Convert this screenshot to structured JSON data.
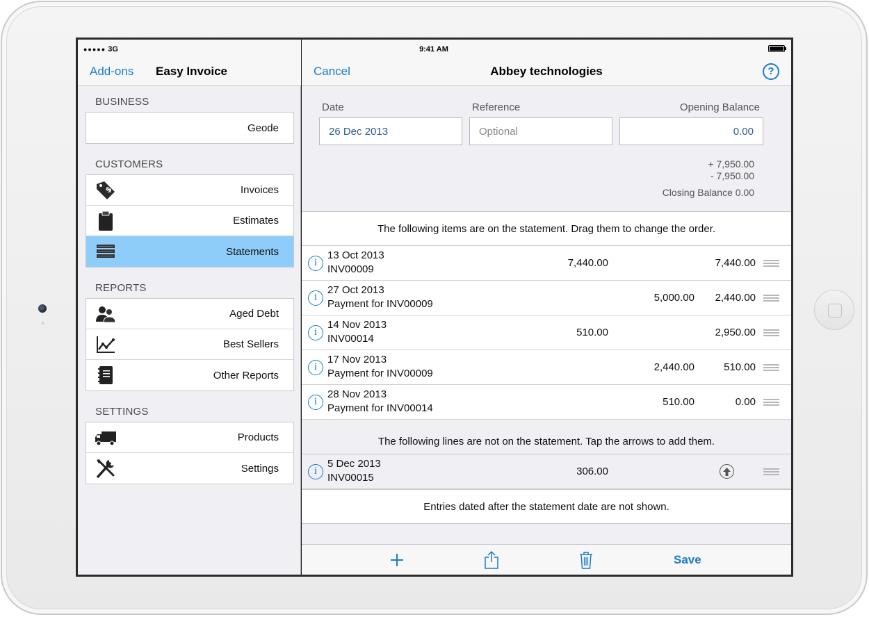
{
  "status": {
    "carrier": "3G",
    "time": "9:41 AM"
  },
  "master": {
    "addons_label": "Add-ons",
    "title": "Easy Invoice",
    "sections": {
      "business": "BUSINESS",
      "customers": "CUSTOMERS",
      "reports": "REPORTS",
      "settings": "SETTINGS"
    },
    "business_item": "Geode",
    "customers_items": [
      {
        "label": "Invoices",
        "icon": "price-tag-icon"
      },
      {
        "label": "Estimates",
        "icon": "clipboard-icon"
      },
      {
        "label": "Statements",
        "icon": "document-stack-icon",
        "selected": true
      }
    ],
    "reports_items": [
      {
        "label": "Aged Debt",
        "icon": "people-icon"
      },
      {
        "label": "Best Sellers",
        "icon": "line-chart-icon"
      },
      {
        "label": "Other Reports",
        "icon": "notebook-icon"
      }
    ],
    "settings_items": [
      {
        "label": "Products",
        "icon": "truck-icon"
      },
      {
        "label": "Settings",
        "icon": "tools-icon"
      }
    ]
  },
  "detail": {
    "cancel_label": "Cancel",
    "title": "Abbey technologies",
    "help_label": "?",
    "form": {
      "date_label": "Date",
      "date_value": "26 Dec 2013",
      "reference_label": "Reference",
      "reference_placeholder": "Optional",
      "opening_label": "Opening Balance",
      "opening_value": "0.00"
    },
    "summary": {
      "plus": "+ 7,950.00",
      "minus": "- 7,950.00",
      "closing": "Closing Balance 0.00"
    },
    "on_statement_notice": "The following items are on the statement. Drag them to change the order.",
    "entries": [
      {
        "date": "13 Oct 2013",
        "desc": "INV00009",
        "debit": "7,440.00",
        "credit": "",
        "balance": "7,440.00"
      },
      {
        "date": "27 Oct 2013",
        "desc": "Payment for INV00009",
        "debit": "",
        "credit": "5,000.00",
        "balance": "2,440.00"
      },
      {
        "date": "14 Nov 2013",
        "desc": "INV00014",
        "debit": "510.00",
        "credit": "",
        "balance": "2,950.00"
      },
      {
        "date": "17 Nov 2013",
        "desc": "Payment for INV00009",
        "debit": "",
        "credit": "2,440.00",
        "balance": "510.00"
      },
      {
        "date": "28 Nov 2013",
        "desc": "Payment for INV00014",
        "debit": "",
        "credit": "510.00",
        "balance": "0.00"
      }
    ],
    "off_statement_notice": "The following lines are not on the statement. Tap the arrows to add them.",
    "off_entries": [
      {
        "date": "5 Dec 2013",
        "desc": "INV00015",
        "debit": "306.00"
      }
    ],
    "footer_notice": "Entries dated after the statement date are not shown.",
    "toolbar": {
      "save_label": "Save"
    }
  },
  "colors": {
    "accent": "#1a7bc9",
    "selected": "#8ecdf9",
    "background": "#efeff4"
  }
}
